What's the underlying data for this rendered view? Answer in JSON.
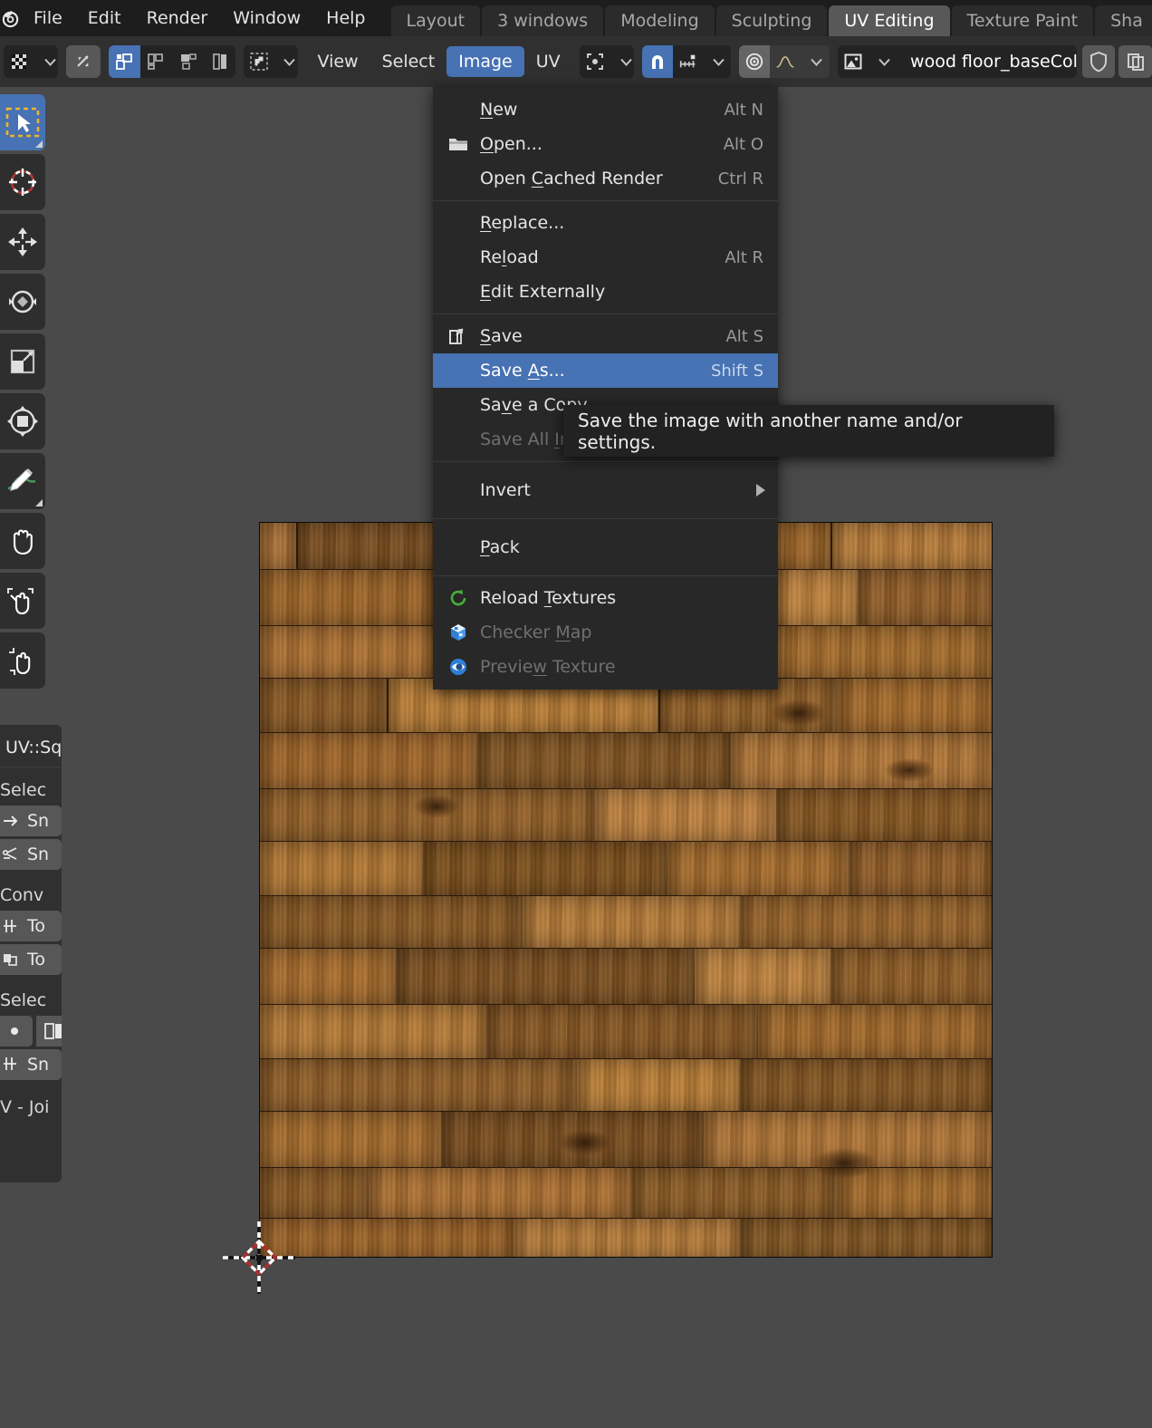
{
  "app": {
    "logo_icon": "blender-logo"
  },
  "topbar": {
    "menus": [
      "File",
      "Edit",
      "Render",
      "Window",
      "Help"
    ],
    "workspace_tabs": [
      {
        "label": "Layout",
        "active": false
      },
      {
        "label": "3 windows",
        "active": false
      },
      {
        "label": "Modeling",
        "active": false
      },
      {
        "label": "Sculpting",
        "active": false
      },
      {
        "label": "UV Editing",
        "active": true
      },
      {
        "label": "Texture Paint",
        "active": false
      },
      {
        "label": "Sha",
        "active": false
      }
    ]
  },
  "header": {
    "editor_type_icon": "uv-editor-icon",
    "uv_sync_icon": "uv-sync-selection-icon",
    "select_modes": [
      {
        "icon": "uv-vertex-select-icon",
        "active": true
      },
      {
        "icon": "uv-edge-select-icon",
        "active": false
      },
      {
        "icon": "uv-face-select-icon",
        "active": false
      },
      {
        "icon": "uv-island-select-icon",
        "active": false
      }
    ],
    "sticky_icon": "sticky-selection-icon",
    "menus": [
      {
        "label": "View",
        "active": false
      },
      {
        "label": "Select",
        "active": false
      },
      {
        "label": "Image",
        "active": true
      },
      {
        "label": "UV",
        "active": false
      }
    ],
    "pivot_icon": "pivot-point-icon",
    "snap_magnet_icon": "snap-magnet-icon",
    "snap_magnet_on": true,
    "snap_to_icon": "snap-to-increment-icon",
    "proportional_icon": "proportional-editing-icon",
    "proportional_on": true,
    "falloff_icon": "falloff-curve-icon",
    "image_browse_icon": "image-datablock-icon",
    "image_name": "wood floor_baseColo..",
    "fake_user_icon": "shield-icon",
    "new_image_icon": "duplicate-icon"
  },
  "left_toolbar": [
    {
      "icon": "tweak-select-box-icon",
      "active": true
    },
    {
      "icon": "cursor-icon",
      "active": false
    },
    {
      "icon": "move-icon",
      "active": false
    },
    {
      "icon": "rotate-icon",
      "active": false
    },
    {
      "icon": "scale-icon",
      "active": false
    },
    {
      "icon": "transform-icon",
      "active": false
    },
    {
      "icon": "annotate-icon",
      "active": false
    },
    {
      "icon": "grab-hand-icon",
      "active": false
    },
    {
      "icon": "pinch-hand-icon",
      "active": false
    },
    {
      "icon": "expand-hand-icon",
      "active": false
    }
  ],
  "side_panel": {
    "title": "UV::Sq",
    "section_1_label": "Selec",
    "buttons_1": [
      {
        "label": "Sn",
        "icon": "arrow-right-icon"
      },
      {
        "label": "Sn",
        "icon": "snap-cross-icon"
      }
    ],
    "section_2_label": "Conv",
    "buttons_2": [
      {
        "label": "To",
        "icon": "to-edge-icon"
      },
      {
        "label": "To",
        "icon": "to-face-icon"
      }
    ],
    "section_3_label": "Selec",
    "toggle_row": [
      {
        "icon": "dot-icon"
      },
      {
        "icon": "split-bar-icon"
      }
    ],
    "button_3": {
      "label": "Sn",
      "icon": "snap-vertex-icon"
    },
    "footer_label": "V - Joi"
  },
  "image_menu": {
    "groups": [
      {
        "items": [
          {
            "label": "New",
            "accel": "N",
            "shortcut": "Alt N",
            "icon": null,
            "state": "normal"
          },
          {
            "label": "Open...",
            "accel": "O",
            "shortcut": "Alt O",
            "icon": "folder-icon",
            "state": "normal"
          },
          {
            "label": "Open Cached Render",
            "accel": "C",
            "shortcut": "Ctrl R",
            "icon": null,
            "state": "normal"
          }
        ]
      },
      {
        "items": [
          {
            "label": "Replace...",
            "accel": "R",
            "shortcut": "",
            "icon": null,
            "state": "normal"
          },
          {
            "label": "Reload",
            "accel": "l",
            "shortcut": "Alt R",
            "icon": null,
            "state": "normal"
          },
          {
            "label": "Edit Externally",
            "accel": "E",
            "shortcut": "",
            "icon": null,
            "state": "normal"
          }
        ]
      },
      {
        "items": [
          {
            "label": "Save",
            "accel": "S",
            "shortcut": "Alt S",
            "icon": "save-icon",
            "state": "normal"
          },
          {
            "label": "Save As...",
            "accel": "A",
            "shortcut": "Shift S",
            "icon": null,
            "state": "selected"
          },
          {
            "label": "Save a Copy...",
            "accel": "v",
            "shortcut": "",
            "icon": null,
            "state": "normal"
          },
          {
            "label": "Save All Images",
            "accel": "I",
            "shortcut": "",
            "icon": null,
            "state": "disabled"
          }
        ]
      },
      {
        "items": [
          {
            "label": "Invert",
            "accel": "",
            "shortcut": "",
            "icon": null,
            "state": "normal",
            "submenu": true
          }
        ]
      },
      {
        "items": [
          {
            "label": "Pack",
            "accel": "P",
            "shortcut": "",
            "icon": null,
            "state": "normal"
          }
        ]
      },
      {
        "items": [
          {
            "label": "Reload Textures",
            "accel": "T",
            "shortcut": "",
            "icon": "reload-textures-icon",
            "state": "normal"
          },
          {
            "label": "Checker Map",
            "accel": "M",
            "shortcut": "",
            "icon": "checker-map-icon",
            "state": "disabled"
          },
          {
            "label": "Preview Texture",
            "accel": "w",
            "shortcut": "",
            "icon": "preview-texture-icon",
            "state": "disabled"
          }
        ]
      }
    ]
  },
  "tooltip": {
    "text": "Save the image with another name and/or settings."
  },
  "canvas": {
    "cursor_icon": "2d-cursor-icon",
    "image_alt": "wood floor base color texture"
  },
  "colors": {
    "accent_blue": "#4772b3",
    "topbar_bg": "#1d1d1d",
    "header_bg": "#303030",
    "canvas_bg": "#4a4a4a",
    "menu_bg": "#282828",
    "wood_light": "#c8833f",
    "wood_mid": "#a8712f",
    "wood_dark": "#5c3a18"
  }
}
